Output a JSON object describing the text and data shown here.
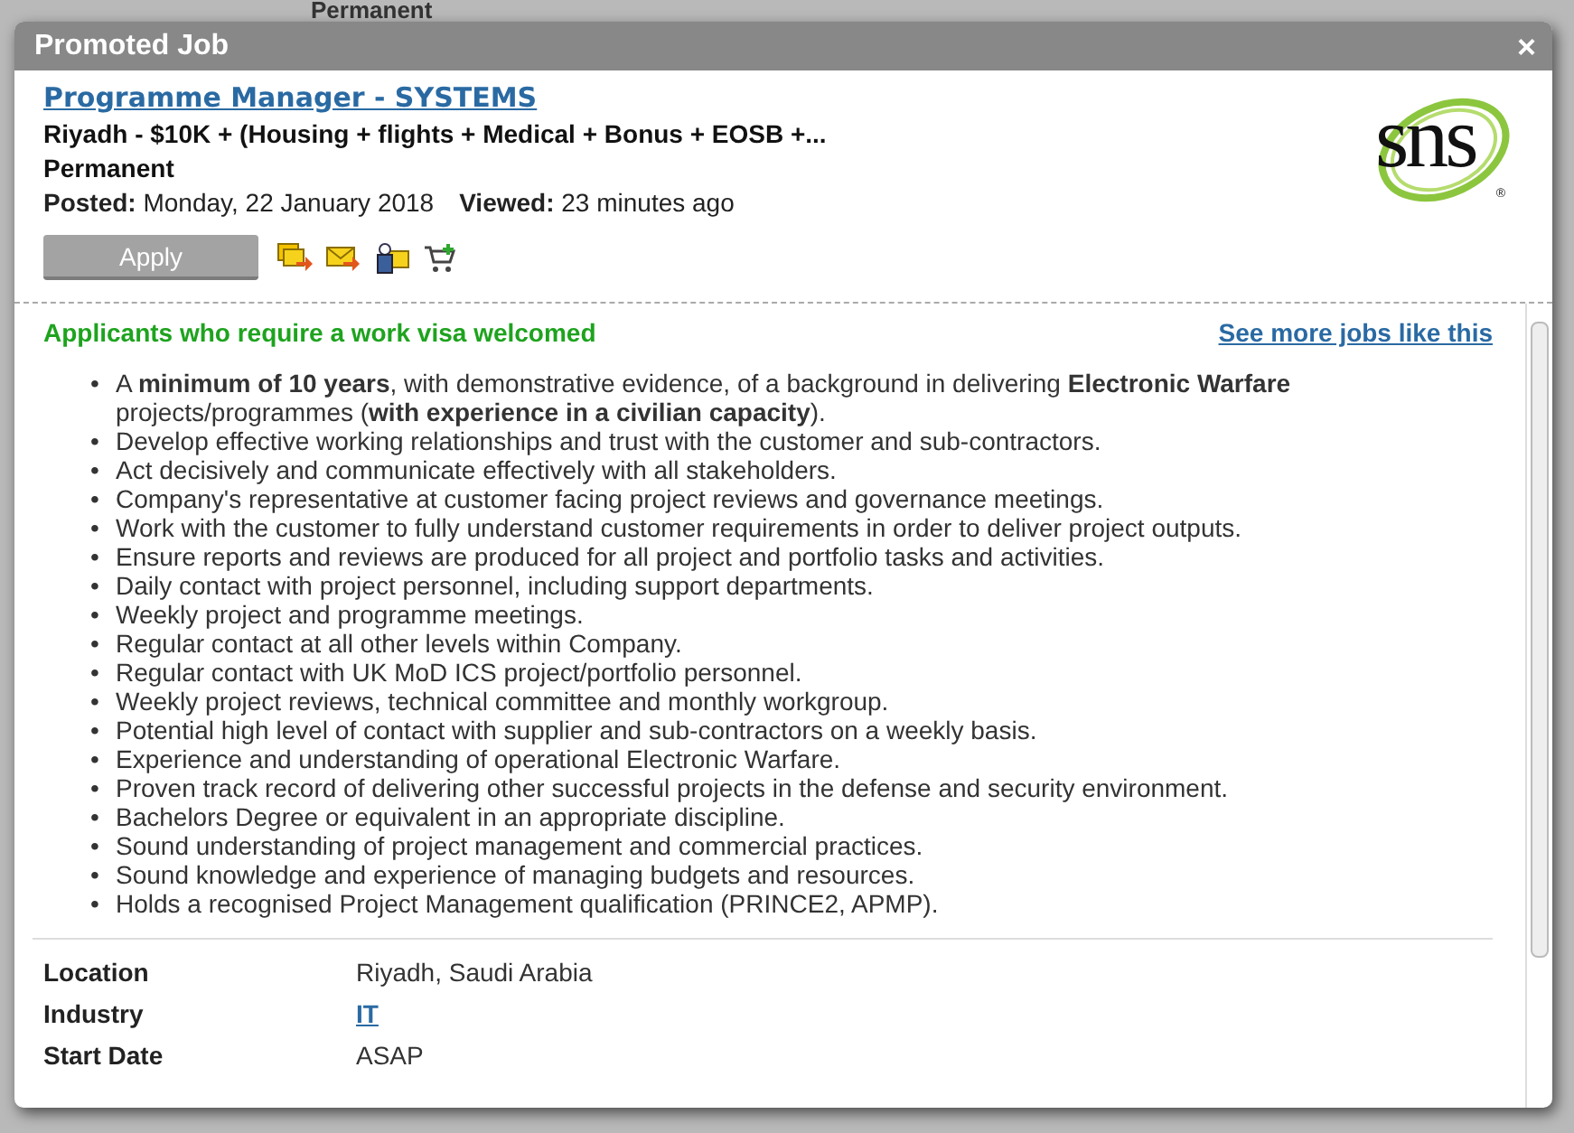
{
  "background": {
    "top_text": "Permanent"
  },
  "bullet": "•",
  "dialog": {
    "title": "Promoted Job",
    "close": "×"
  },
  "job": {
    "title": "Programme Manager - SYSTEMS",
    "salary": "Riyadh - $10K + (Housing + flights + Medical + Bonus + EOSB +...",
    "type": "Permanent",
    "posted_label": "Posted:",
    "posted": "Monday, 22 January 2018",
    "viewed_label": "Viewed:",
    "viewed": "23 minutes ago",
    "apply": "Apply",
    "logo_text": "sns",
    "logo_mark": "®"
  },
  "visa_note": "Applicants who require a work visa welcomed",
  "more_link": "See more jobs like this",
  "requirements": [
    "A **minimum of 10 years**, with demonstrative evidence, of a background in delivering **Electronic Warfare** projects/programmes (**with experience in a civilian capacity**).",
    "Develop effective working relationships and trust with the customer and sub-contractors.",
    "Act decisively and communicate effectively with all stakeholders.",
    "Company's representative at customer facing project reviews and governance meetings.",
    "Work with the customer to fully understand customer requirements in order to deliver project outputs.",
    "Ensure reports and reviews are produced for all project and portfolio tasks and activities.",
    "Daily contact with project personnel, including support departments.",
    "Weekly project and programme meetings.",
    "Regular contact at all other levels within Company.",
    "Regular contact with UK MoD ICS project/portfolio personnel.",
    "Weekly project reviews, technical committee and monthly workgroup.",
    "Potential high level of contact with supplier and sub-contractors on a weekly basis.",
    "Experience and understanding of operational Electronic Warfare.",
    "Proven track record of delivering other successful projects in the defense and security environment.",
    "Bachelors Degree or equivalent in an appropriate discipline.",
    "Sound understanding of project management and commercial practices.",
    "Sound knowledge and experience of managing budgets and resources.",
    "Holds a recognised Project Management qualification (PRINCE2, APMP)."
  ],
  "details": [
    {
      "label": "Location",
      "value": "Riyadh, Saudi Arabia",
      "kind": "text"
    },
    {
      "label": "Industry",
      "value": "IT",
      "kind": "link"
    },
    {
      "label": "Start Date",
      "value": "ASAP",
      "kind": "text"
    }
  ]
}
